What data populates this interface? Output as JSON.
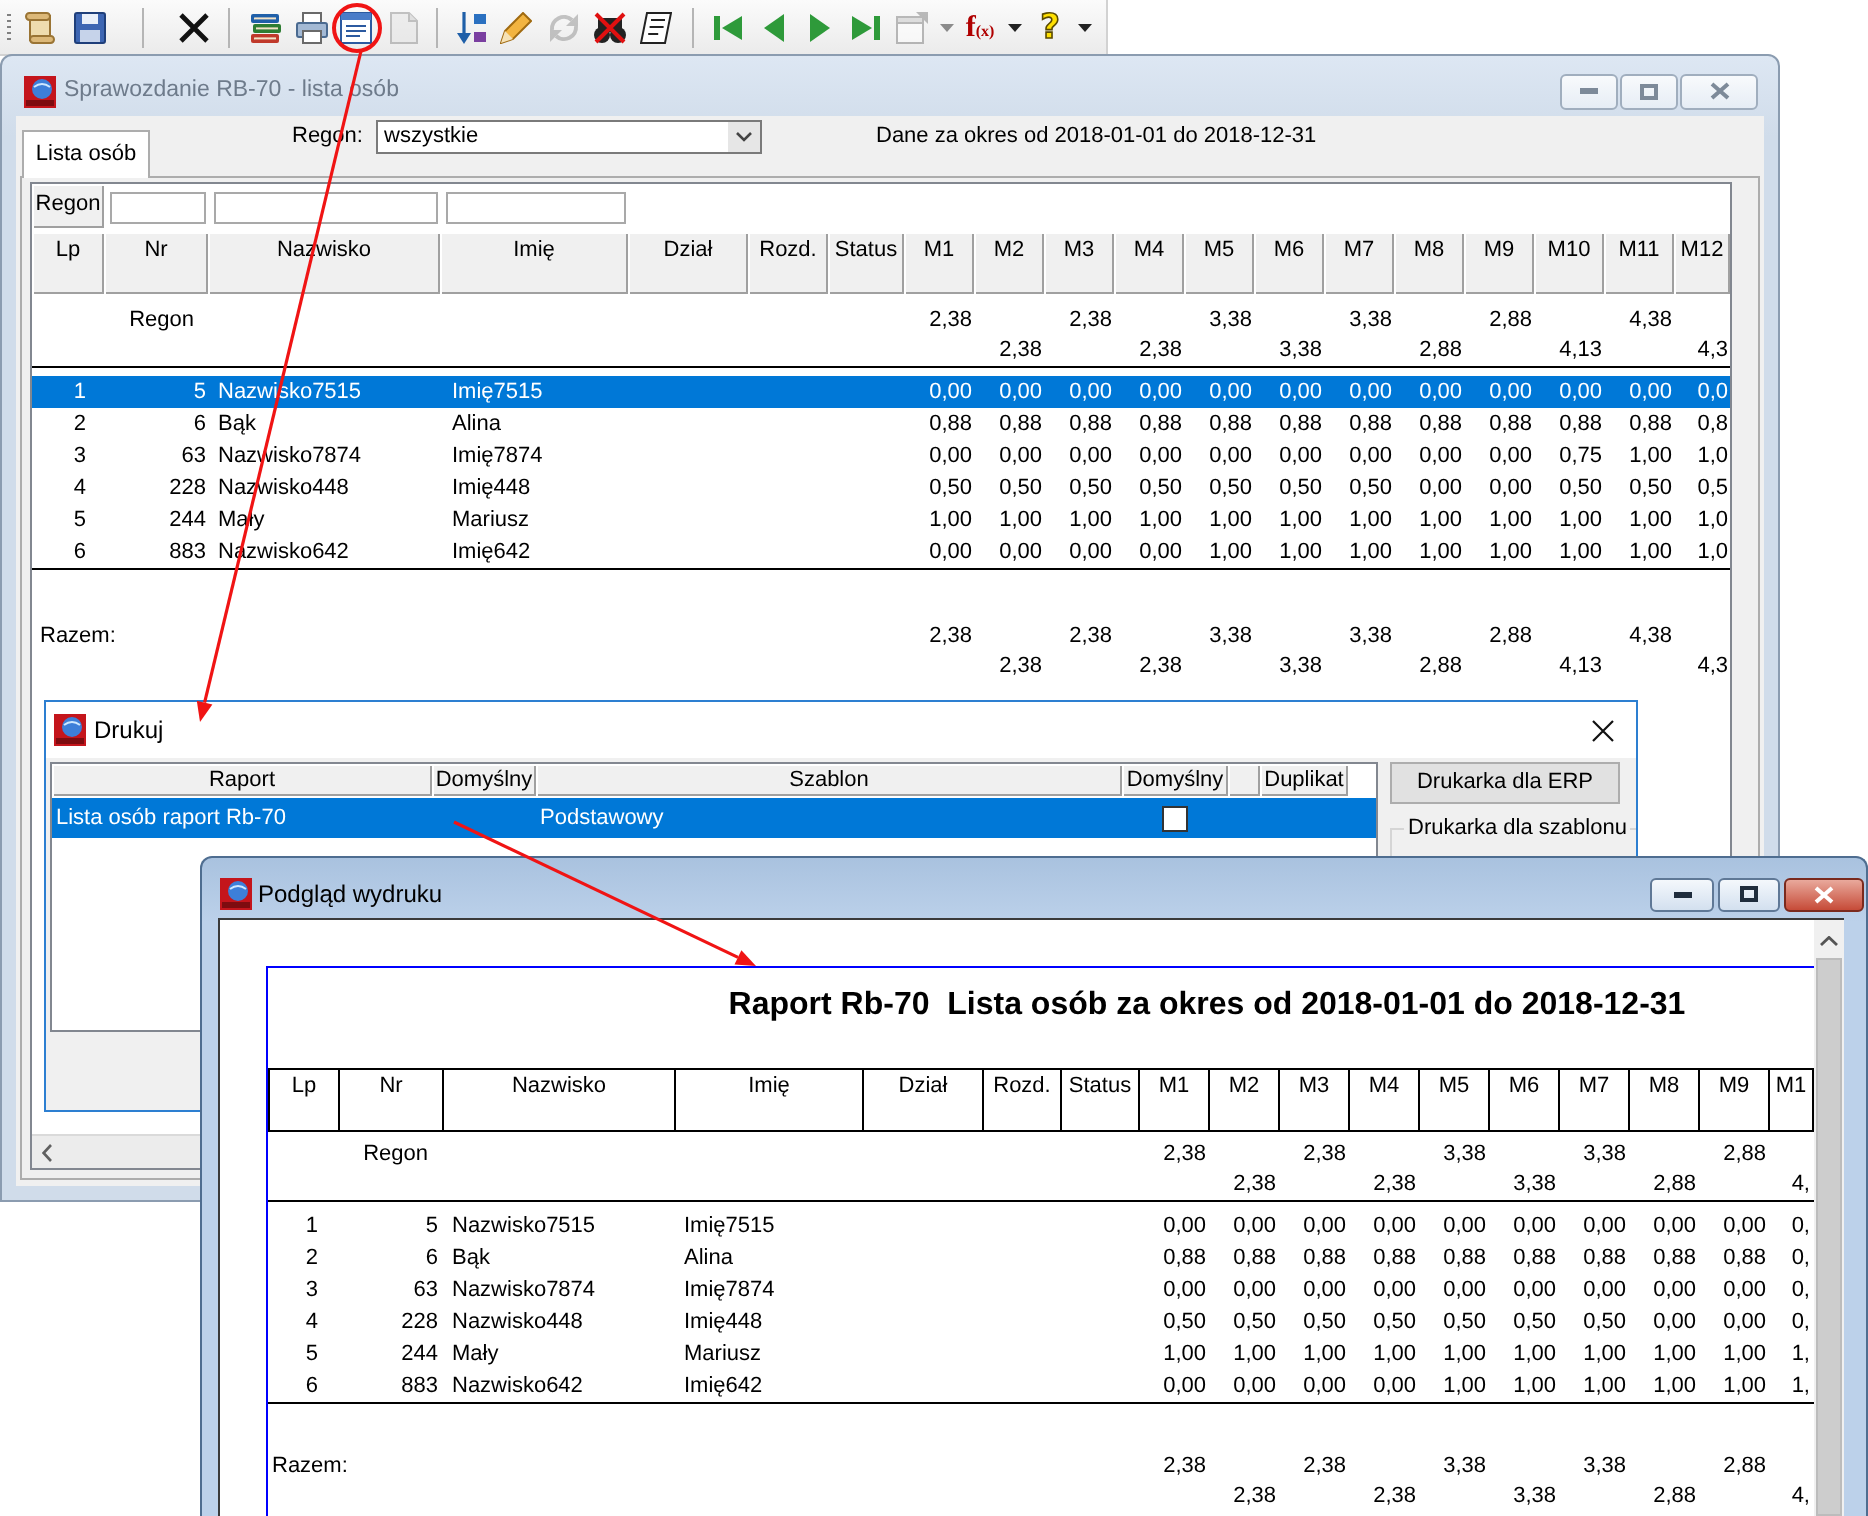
{
  "toolbar": [
    {
      "disabled": false,
      "dropdown": false
    },
    {
      "disabled": false,
      "dropdown": false
    },
    {
      "disabled": false,
      "dropdown": false
    },
    {
      "disabled": false,
      "dropdown": false
    },
    {
      "disabled": false,
      "dropdown": false
    },
    {
      "disabled": false,
      "dropdown": false
    },
    {
      "disabled": true,
      "dropdown": false
    },
    {
      "disabled": false,
      "dropdown": false
    },
    {
      "disabled": false,
      "dropdown": false
    },
    {
      "disabled": true,
      "dropdown": false
    },
    {
      "disabled": false,
      "dropdown": false
    },
    {
      "disabled": false,
      "dropdown": false
    },
    {
      "disabled": false,
      "dropdown": false
    },
    {
      "disabled": false,
      "dropdown": false
    },
    {
      "disabled": false,
      "dropdown": false
    },
    {
      "disabled": false,
      "dropdown": false
    },
    {
      "disabled": true,
      "dropdown": true
    },
    {
      "label": "f$_{(x)}$",
      "disabled": false,
      "dropdown": true
    },
    {
      "label": "?",
      "disabled": false,
      "dropdown": true
    }
  ],
  "main_window": {
    "title": "Sprawozdanie RB-70 - lista osób",
    "active": false,
    "tabs": [
      {
        "label": "Lista osób",
        "selected": true
      }
    ],
    "region_filter": {
      "label": "Regon:",
      "value": "wszystkie"
    },
    "period": "Dane za okres od 2018-01-01 do 2018-12-31",
    "grid": {
      "filter_label": "Regon",
      "columns": [
        {
          "label": "Lp",
          "filter": false
        },
        {
          "label": "Nr",
          "filter": true
        },
        {
          "label": "Nazwisko",
          "filter": true
        },
        {
          "label": "Imię",
          "filter": true
        },
        {
          "label": "Dział",
          "filter": false
        },
        {
          "label": "Rozd.",
          "filter": false
        },
        {
          "label": "Status",
          "filter": false
        },
        {
          "label": "M1",
          "filter": false
        },
        {
          "label": "M2",
          "filter": false
        },
        {
          "label": "M3",
          "filter": false
        },
        {
          "label": "M4",
          "filter": false
        },
        {
          "label": "M5",
          "filter": false
        },
        {
          "label": "M6",
          "filter": false
        },
        {
          "label": "M7",
          "filter": false
        },
        {
          "label": "M8",
          "filter": false
        },
        {
          "label": "M9",
          "filter": false
        },
        {
          "label": "M10",
          "filter": false
        },
        {
          "label": "M11",
          "filter": false
        },
        {
          "label": "M12",
          "filter": false
        }
      ],
      "group_row": {
        "label": "Regon",
        "values": [
          "2,38",
          "2,38",
          "2,38",
          "2,38",
          "3,38",
          "3,38",
          "3,38",
          "2,88",
          "2,88",
          "4,13",
          "4,38",
          "4,3"
        ]
      },
      "rows": [
        {
          "lp": "1",
          "nr": "5",
          "surname": "Nazwisko7515",
          "first_name": "Imię7515",
          "months": [
            "0,00",
            "0,00",
            "0,00",
            "0,00",
            "0,00",
            "0,00",
            "0,00",
            "0,00",
            "0,00",
            "0,00",
            "0,00",
            "0,0"
          ],
          "selected": true
        },
        {
          "lp": "2",
          "nr": "6",
          "surname": "Bąk",
          "first_name": "Alina",
          "months": [
            "0,88",
            "0,88",
            "0,88",
            "0,88",
            "0,88",
            "0,88",
            "0,88",
            "0,88",
            "0,88",
            "0,88",
            "0,88",
            "0,8"
          ],
          "selected": false
        },
        {
          "lp": "3",
          "nr": "63",
          "surname": "Nazwisko7874",
          "first_name": "Imię7874",
          "months": [
            "0,00",
            "0,00",
            "0,00",
            "0,00",
            "0,00",
            "0,00",
            "0,00",
            "0,00",
            "0,00",
            "0,75",
            "1,00",
            "1,0"
          ],
          "selected": false
        },
        {
          "lp": "4",
          "nr": "228",
          "surname": "Nazwisko448",
          "first_name": "Imię448",
          "months": [
            "0,50",
            "0,50",
            "0,50",
            "0,50",
            "0,50",
            "0,50",
            "0,50",
            "0,00",
            "0,00",
            "0,50",
            "0,50",
            "0,5"
          ],
          "selected": false
        },
        {
          "lp": "5",
          "nr": "244",
          "surname": "Mały",
          "first_name": "Mariusz",
          "months": [
            "1,00",
            "1,00",
            "1,00",
            "1,00",
            "1,00",
            "1,00",
            "1,00",
            "1,00",
            "1,00",
            "1,00",
            "1,00",
            "1,0"
          ],
          "selected": false
        },
        {
          "lp": "6",
          "nr": "883",
          "surname": "Nazwisko642",
          "first_name": "Imię642",
          "months": [
            "0,00",
            "0,00",
            "0,00",
            "0,00",
            "1,00",
            "1,00",
            "1,00",
            "1,00",
            "1,00",
            "1,00",
            "1,00",
            "1,0"
          ],
          "selected": false
        }
      ],
      "total_row": {
        "label": "Razem:",
        "values": [
          "2,38",
          "2,38",
          "2,38",
          "2,38",
          "3,38",
          "3,38",
          "3,38",
          "2,88",
          "2,88",
          "4,13",
          "4,38",
          "4,3"
        ]
      }
    }
  },
  "print_dialog": {
    "title": "Drukuj",
    "active": true,
    "columns": [
      {
        "label": "Raport"
      },
      {
        "label": "Domyślny"
      },
      {
        "label": "Szablon"
      },
      {
        "label": "Domyślny"
      },
      {},
      {
        "label": "Duplikat"
      }
    ],
    "rows": [
      {
        "report": "Lista osób raport Rb-70",
        "template": "Podstawowy",
        "default": false,
        "selected": true
      }
    ],
    "printer_button": "Drukarka dla ERP",
    "template_printer_group": "Drukarka dla szablonu"
  },
  "preview_window": {
    "title": "Podgląd wydruku",
    "active": true,
    "report": {
      "title": "Raport Rb-70  Lista osób za okres od 2018-01-01 do 2018-12-31",
      "columns": [
        "Lp",
        "Nr",
        "Nazwisko",
        "Imię",
        "Dział",
        "Rozd.",
        "Status",
        "M1",
        "M2",
        "M3",
        "M4",
        "M5",
        "M6",
        "M7",
        "M8",
        "M9",
        "M1"
      ],
      "group_row": {
        "label": "Regon",
        "values": [
          "2,38",
          "2,38",
          "2,38",
          "2,38",
          "3,38",
          "3,38",
          "3,38",
          "2,88",
          "2,88",
          "4,"
        ]
      },
      "rows": [
        {
          "lp": "1",
          "nr": "5",
          "surname": "Nazwisko7515",
          "first_name": "Imię7515",
          "months": [
            "0,00",
            "0,00",
            "0,00",
            "0,00",
            "0,00",
            "0,00",
            "0,00",
            "0,00",
            "0,00",
            "0,"
          ]
        },
        {
          "lp": "2",
          "nr": "6",
          "surname": "Bąk",
          "first_name": "Alina",
          "months": [
            "0,88",
            "0,88",
            "0,88",
            "0,88",
            "0,88",
            "0,88",
            "0,88",
            "0,88",
            "0,88",
            "0,"
          ]
        },
        {
          "lp": "3",
          "nr": "63",
          "surname": "Nazwisko7874",
          "first_name": "Imię7874",
          "months": [
            "0,00",
            "0,00",
            "0,00",
            "0,00",
            "0,00",
            "0,00",
            "0,00",
            "0,00",
            "0,00",
            "0,"
          ]
        },
        {
          "lp": "4",
          "nr": "228",
          "surname": "Nazwisko448",
          "first_name": "Imię448",
          "months": [
            "0,50",
            "0,50",
            "0,50",
            "0,50",
            "0,50",
            "0,50",
            "0,50",
            "0,00",
            "0,00",
            "0,"
          ]
        },
        {
          "lp": "5",
          "nr": "244",
          "surname": "Mały",
          "first_name": "Mariusz",
          "months": [
            "1,00",
            "1,00",
            "1,00",
            "1,00",
            "1,00",
            "1,00",
            "1,00",
            "1,00",
            "1,00",
            "1,"
          ]
        },
        {
          "lp": "6",
          "nr": "883",
          "surname": "Nazwisko642",
          "first_name": "Imię642",
          "months": [
            "0,00",
            "0,00",
            "0,00",
            "0,00",
            "1,00",
            "1,00",
            "1,00",
            "1,00",
            "1,00",
            "1,"
          ]
        }
      ],
      "total_row": {
        "label": "Razem:",
        "values": [
          "2,38",
          "2,38",
          "2,38",
          "2,38",
          "3,38",
          "3,38",
          "3,38",
          "2,88",
          "2,88",
          "4,"
        ]
      }
    }
  }
}
